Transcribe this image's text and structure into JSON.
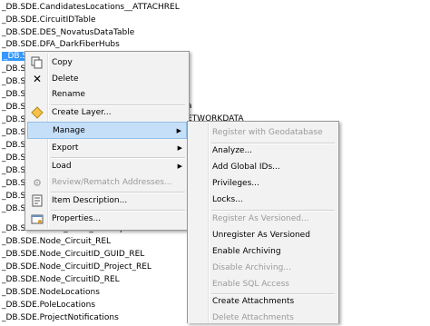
{
  "tree": {
    "rows": [
      {
        "label": "_DB.SDE.CandidatesLocations__ATTACHREL"
      },
      {
        "label": "_DB.SDE.CircuitIDTable"
      },
      {
        "label": "_DB.SDE.DES_NovatusDataTable"
      },
      {
        "label": "_DB.SDE.DFA_DarkFiberHubs"
      },
      {
        "label": "_DB.SDE"
      },
      {
        "label": "_DB.SDE"
      },
      {
        "label": "_DB.SDE"
      },
      {
        "label": "_DB.SDE"
      },
      {
        "label": "_DB.SDE"
      },
      {
        "label": "_DB.SDE"
      },
      {
        "label": "_DB.SDE"
      },
      {
        "label": "_DB.SDE"
      },
      {
        "label": "_DB.SDE"
      },
      {
        "label": "_DB.SDE"
      },
      {
        "label": "_DB.SDE"
      },
      {
        "label": "_DB.SDE"
      },
      {
        "label": "_DB.SDE"
      },
      {
        "label": "_DB.SDE.NODE_MUNI_Municipalities"
      },
      {
        "label": "_DB.SDE.Node_Circuit_REL"
      },
      {
        "label": "_DB.SDE.Node_CircuitID_GUID_REL"
      },
      {
        "label": "_DB.SDE.Node_CircuitID_Project_REL"
      },
      {
        "label": "_DB.SDE.Node_CircuitID_REL"
      },
      {
        "label": "_DB.SDE.NodeLocations"
      },
      {
        "label": "_DB.SDE.PoleLocations"
      },
      {
        "label": "_DB.SDE.ProjectNotifications"
      }
    ],
    "partial_a": "a",
    "partial_networkdata": "ETWORKDATA"
  },
  "context_menu": {
    "items": {
      "copy": "Copy",
      "delete": "Delete",
      "rename": "Rename",
      "create_layer": "Create Layer...",
      "manage": "Manage",
      "export": "Export",
      "load": "Load",
      "review_rematch": "Review/Rematch Addresses...",
      "item_description": "Item Description...",
      "properties": "Properties..."
    },
    "submenu_arrow": "▶"
  },
  "manage_submenu": {
    "register_geodatabase": "Register with Geodatabase",
    "analyze": "Analyze...",
    "add_global_ids": "Add Global IDs...",
    "privileges": "Privileges...",
    "locks": "Locks...",
    "register_versioned": "Register As Versioned...",
    "unregister_versioned": "Unregister As Versioned",
    "enable_archiving": "Enable Archiving",
    "disable_archiving": "Disable Archiving...",
    "enable_sql_access": "Enable SQL Access",
    "create_attachments": "Create Attachments",
    "delete_attachments": "Delete Attachments"
  },
  "colors": {
    "selection": "#3399ff",
    "menu_bg": "#f2f2f2",
    "highlight": "#c6dff8",
    "disabled_text": "#9a9a9a"
  },
  "icons": {
    "copy": "copy-icon",
    "delete": "delete-x-icon",
    "create_layer": "layer-diamond-icon",
    "review": "review-addresses-icon",
    "item_description": "item-description-icon",
    "properties": "properties-icon"
  }
}
